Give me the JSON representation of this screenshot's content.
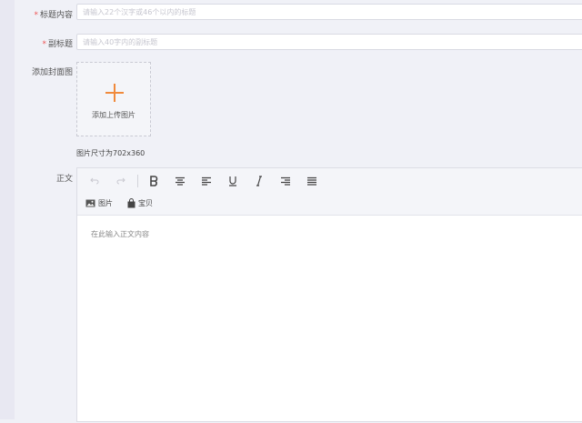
{
  "form": {
    "title_label": "标题内容",
    "title_placeholder": "请输入22个汉字或46个以内的标题",
    "subtitle_label": "副标题",
    "subtitle_placeholder": "请输入40字内的副标题",
    "cover_label": "添加封面图",
    "upload_text": "添加上传图片",
    "size_hint": "图片尺寸为702x360",
    "body_label": "正文"
  },
  "editor": {
    "image_button": "图片",
    "treasure_button": "宝贝",
    "placeholder": "在此输入正文内容"
  },
  "colors": {
    "accent": "#f08a3c",
    "required": "#ee5555"
  }
}
